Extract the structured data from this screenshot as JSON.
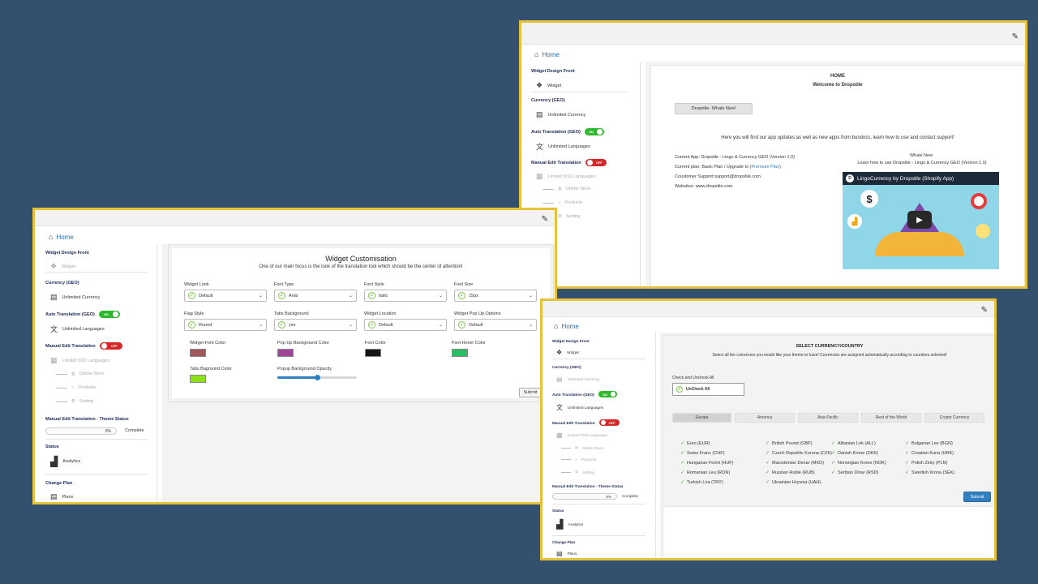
{
  "icons": {
    "edit": "edit-icon",
    "home": "home-icon",
    "widget": "widget-icon",
    "currency": "currency-icon",
    "languages": "languages-icon",
    "store": "store-icon",
    "products": "tag-icon",
    "setting": "gear-icon",
    "analytics": "analytics-icon",
    "plans": "plans-icon",
    "check": "check-icon",
    "caret": "chevron-down-icon",
    "play": "play-icon"
  },
  "colors": {
    "background": "#33506e",
    "frame": "#e6c23a",
    "accent": "#2f7fc1",
    "toggle_on": "#2eb82e",
    "toggle_off": "#d62828",
    "nav_title": "#1f2a57"
  },
  "sidebar": {
    "widget_design_title": "Widget Design Front",
    "widget_label": "Widget",
    "currency_title": "Currency (GEO)",
    "unlimited_currency": "Unlimited Currency",
    "auto_translation_title": "Auto Translation (GEO)",
    "toggle_on": "ON",
    "unlimited_languages": "Unlimited Languages",
    "manual_edit_title": "Manual Edit Translation",
    "toggle_off": "OFF",
    "limited_languages": "Limited 0/10 Languages",
    "online_store": "Online Store",
    "products": "Products",
    "setting": "Setting",
    "theme_status_title": "Manual Edit Translation - Theme Status",
    "progress_pct": "0%",
    "progress_value": 0,
    "complete": "Complete",
    "status_title": "Status",
    "analytics": "Analytics",
    "change_plan_title": "Change Plan",
    "plans": "Plans"
  },
  "home_link": "Home",
  "home_window": {
    "heading": "HOME",
    "welcome": "Welcome to Dropstile",
    "whats_new_button": "Dropstile- Whats New!",
    "intro": "Here you will find our app updates as well as new apps from bundocs, learn how to use and contact support!",
    "current_app": "Current App: Dropstile - Lingo & Currency GEO (Version 1.0)",
    "current_plan_prefix": "Current plan: Basic Plan / Upgrade to (",
    "premium_link": "Premium Plan",
    "current_plan_suffix": ")",
    "support": "Coustomer Support:support@dropstile.com",
    "websites": "Websites: www.dropstile.com",
    "whats_new_title": "Whats New",
    "learn": "Learn how to use Dropstile - Lingo & Currency GEO (Version 1.0)",
    "video_title": "LingoCurrency by Dropstile (Shopify App)",
    "cut_theme_status": "Translation - Theme Status",
    "cut_analytics": "lytics"
  },
  "widget_window": {
    "title": "Widget Customisation",
    "subtitle": "One of our main focus is the look of the translation tool which should be the center of attention!",
    "fields_row1": [
      {
        "label": "Widget Look",
        "value": "Default"
      },
      {
        "label": "Font Type",
        "value": "Arial"
      },
      {
        "label": "Font Style",
        "value": "Italic"
      },
      {
        "label": "Font Size",
        "value": "15px"
      }
    ],
    "fields_row2": [
      {
        "label": "Flag Style",
        "value": "Round"
      },
      {
        "label": "Tabs Background",
        "value": "yes"
      },
      {
        "label": "Widget Location",
        "value": "Default"
      },
      {
        "label": "Widget Pop Up Options",
        "value": "Default"
      }
    ],
    "colors_row1": [
      {
        "label": "Widget Font Color",
        "color": "#a0575a"
      },
      {
        "label": "Pop Up Background Color",
        "color": "#a0449a"
      },
      {
        "label": "Font Color",
        "color": "#151515"
      },
      {
        "label": "Font Hover Color",
        "color": "#2bbd63"
      }
    ],
    "tabs_bg_label": "Tabs Baground Color",
    "tabs_bg_color": "#8ddf1a",
    "opacity_label": "Popup Background Opacity",
    "opacity_value": 0.5,
    "submit": "Submit"
  },
  "currency_window": {
    "title": "SELECT CURRENCY/COUNTRY",
    "subtitle": "Select all the currencies you would like your theme to have! Currencies are assigned automatically according to countries selected!",
    "check_label": "Check and Uncheck All",
    "uncheck_all": "UnCheck All",
    "tabs": [
      "Europe",
      "America",
      "Asia Pacific",
      "Rest of the World",
      "Crypto Currency"
    ],
    "currency_cols": [
      [
        "Euro (EUR)",
        "Swiss Franc (CHF)",
        "Hungarian Forint (HUF)",
        "Romanian Leu (RON)",
        "Turkish Lira (TRY)"
      ],
      [
        "British Pound (GBP)",
        "Czech Republic Koruna (CZK)",
        "Macedonian Denar (MKD)",
        "Russian Ruble (RUB)",
        "Ukrainian Hryvnia (UAH)"
      ],
      [
        "Albanian Lek (ALL)",
        "Danish Krone (DKK)",
        "Norwegian Krone (NOK)",
        "Serbian Dinar (RSD)"
      ],
      [
        "Bulgarian Lev (BGN)",
        "Croatian Kuna (HRK)",
        "Polish Zloty (PLN)",
        "Swedish Krona (SEK)"
      ]
    ],
    "submit": "Submit"
  }
}
